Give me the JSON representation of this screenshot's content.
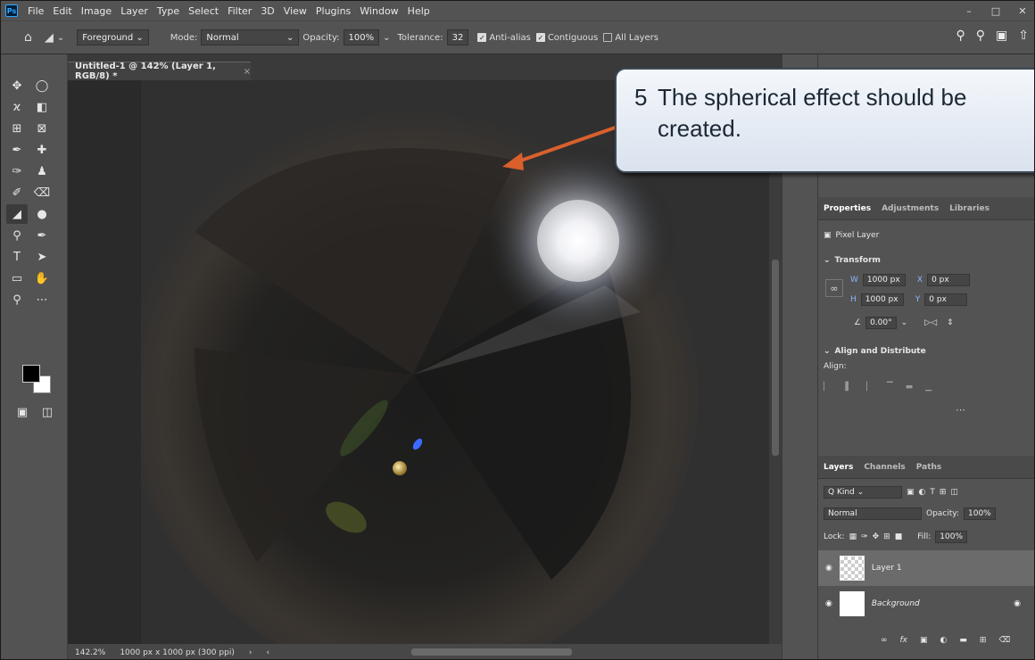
{
  "menubar": {
    "logo": "Ps",
    "items": [
      "File",
      "Edit",
      "Image",
      "Layer",
      "Type",
      "Select",
      "Filter",
      "3D",
      "View",
      "Plugins",
      "Window",
      "Help"
    ]
  },
  "options": {
    "fill_source": "Foreground",
    "mode_label": "Mode:",
    "mode_value": "Normal",
    "opacity_label": "Opacity:",
    "opacity_value": "100%",
    "tolerance_label": "Tolerance:",
    "tolerance_value": "32",
    "antialias_label": "Anti-alias",
    "contiguous_label": "Contiguous",
    "all_layers_label": "All Layers"
  },
  "document": {
    "tab_title": "Untitled-1 @ 142% (Layer 1, RGB/8) *",
    "zoom": "142.2%",
    "doc_info": "1000 px x 1000 px (300 ppi)"
  },
  "callout": {
    "number": "5",
    "line1": "The spherical effect should be",
    "line2": "created."
  },
  "properties": {
    "tabs": [
      "Properties",
      "Adjustments",
      "Libraries"
    ],
    "layer_kind": "Pixel Layer",
    "transform_title": "Transform",
    "w_label": "W",
    "w_value": "1000 px",
    "x_label": "X",
    "x_value": "0 px",
    "h_label": "H",
    "h_value": "1000 px",
    "y_label": "Y",
    "y_value": "0 px",
    "angle_value": "0.00°",
    "align_title": "Align and Distribute",
    "align_label": "Align:"
  },
  "layers_panel": {
    "tabs": [
      "Layers",
      "Channels",
      "Paths"
    ],
    "kind_label": "Q Kind",
    "blend_mode": "Normal",
    "opacity_label": "Opacity:",
    "opacity_value": "100%",
    "lock_label": "Lock:",
    "fill_label": "Fill:",
    "fill_value": "100%",
    "layers": [
      {
        "name": "Layer 1"
      },
      {
        "name": "Background"
      }
    ]
  },
  "colors": {
    "accent": "#31a8ff",
    "panel_bg": "#535353",
    "canvas_bg": "#2a2a2a"
  }
}
